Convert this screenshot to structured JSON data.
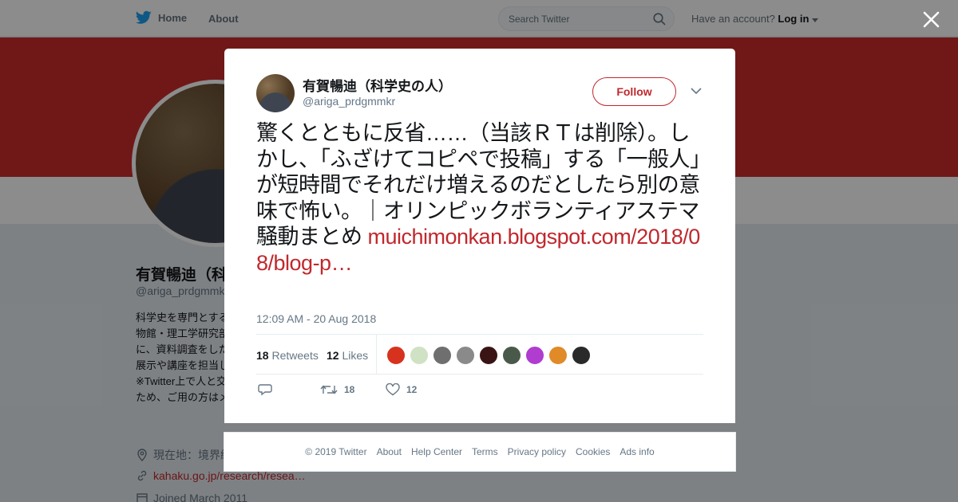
{
  "nav": {
    "home_label": "Home",
    "about_label": "About",
    "search_placeholder": "Search Twitter",
    "account_prompt": "Have an account?",
    "login_label": "Log in"
  },
  "profile": {
    "name": "有賀暢迪（科学史の人）",
    "handle": "@ariga_prdgmmkr",
    "bio": "科学史を専門とする研究者です。国立科学博物館・理工学研究部で、主に物理学史を中心に、資料調査をしたり、科学者資料の整理や展示や講座を担当したりしています。※Twitter上で人と交流することは控えているため、ご用の方はメールでお願いします。",
    "location": "現在地：境界線上",
    "website": "kahaku.go.jp/research/resea…",
    "joined": "Joined March 2011"
  },
  "tweet": {
    "author_name": "有賀暢迪（科学史の人）",
    "author_handle": "@ariga_prdgmmkr",
    "follow_label": "Follow",
    "text": "驚くとともに反省……（当該ＲＴは削除）。しかし、「ふざけてコピペで投稿」する「一般人」が短時間でそれだけ増えるのだとしたら別の意味で怖い。｜オリンピックボランティアステマ騒動まとめ ",
    "link": "muichimonkan.blogspot.com/2018/08/blog-p…",
    "timestamp": "12:09 AM - 20 Aug 2018",
    "retweets_count": "18",
    "retweets_label": "Retweets",
    "likes_count": "12",
    "likes_label": "Likes",
    "action_retweet_count": "18",
    "action_like_count": "12"
  },
  "liker_avatars": [
    {
      "color": "#d7321e"
    },
    {
      "color": "#cfe2c4"
    },
    {
      "color": "#6f6f6f"
    },
    {
      "color": "#8a8a8a"
    },
    {
      "color": "#3a1414"
    },
    {
      "color": "#4a5a4a"
    },
    {
      "color": "#b03cd0"
    },
    {
      "color": "#e08a28"
    },
    {
      "color": "#2a2a2a"
    }
  ],
  "footer": {
    "copyright": "© 2019 Twitter",
    "about": "About",
    "help": "Help Center",
    "terms": "Terms",
    "privacy": "Privacy policy",
    "cookies": "Cookies",
    "ads": "Ads info"
  },
  "colors": {
    "accent": "#c0282d",
    "banner": "#cc2c2c",
    "twitter_blue": "#1da1f2"
  }
}
